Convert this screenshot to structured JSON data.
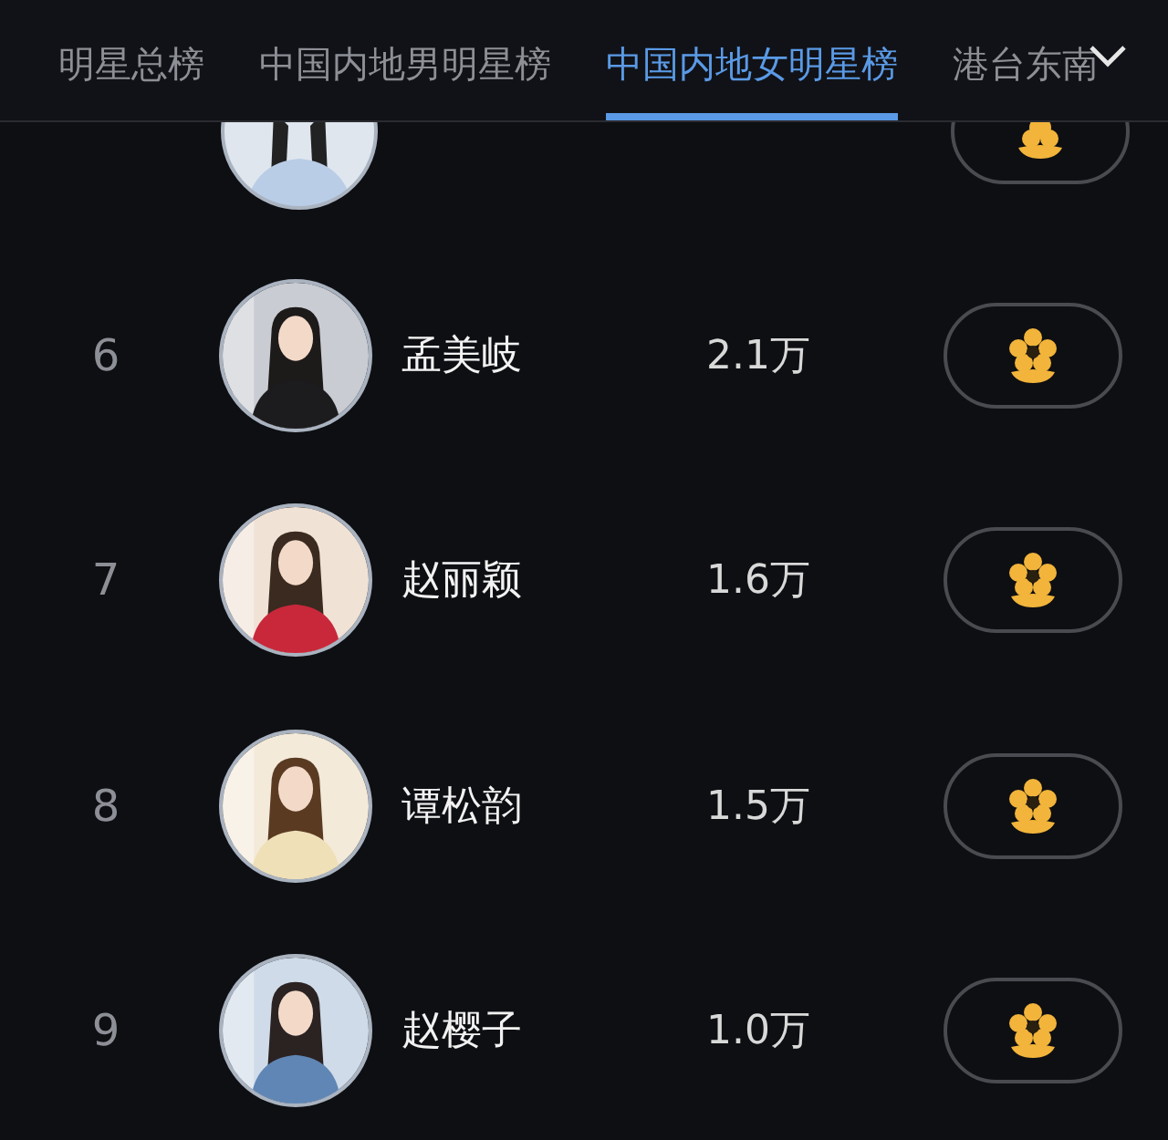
{
  "tabs": [
    {
      "label": "明星总榜",
      "selected": false
    },
    {
      "label": "中国内地男明星榜",
      "selected": false
    },
    {
      "label": "中国内地女明星榜",
      "selected": true
    },
    {
      "label": "港台东南",
      "selected": false
    }
  ],
  "rows": [
    {
      "kind": "cut"
    },
    {
      "kind": "full",
      "rank": "6",
      "name": "孟美岐",
      "count": "2.1万"
    },
    {
      "kind": "full",
      "rank": "7",
      "name": "赵丽颖",
      "count": "1.6万"
    },
    {
      "kind": "full",
      "rank": "8",
      "name": "谭松韵",
      "count": "1.5万"
    },
    {
      "kind": "full",
      "rank": "9",
      "name": "赵樱子",
      "count": "1.0万"
    }
  ]
}
